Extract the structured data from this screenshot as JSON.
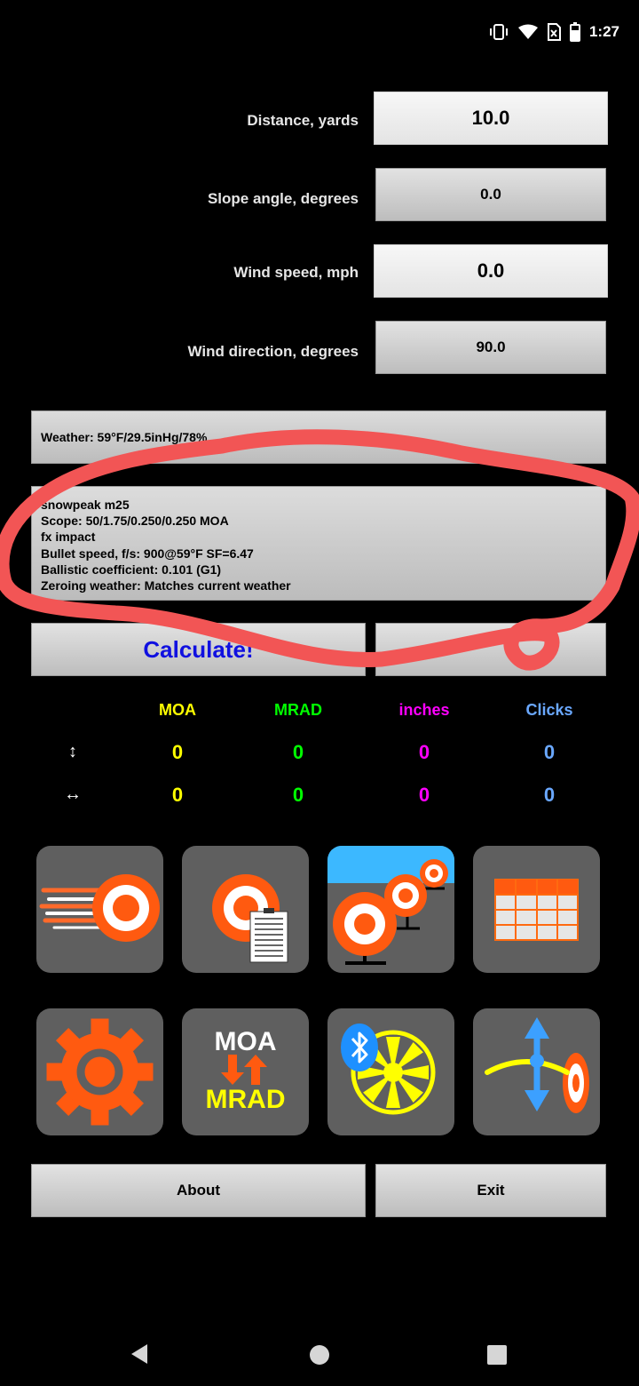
{
  "status": {
    "time": "1:27"
  },
  "inputs": [
    {
      "label": "Distance, yards",
      "value": "10.0"
    },
    {
      "label": "Slope angle, degrees",
      "value": "0.0"
    },
    {
      "label": "Wind speed, mph",
      "value": "0.0"
    },
    {
      "label": "Wind direction, degrees",
      "value": "90.0"
    }
  ],
  "weather": "Weather: 59°F/29.5inHg/78%",
  "profile": {
    "name": "snowpeak m25",
    "scope": "Scope: 50/1.75/0.250/0.250 MOA",
    "ammo": "fx impact",
    "bullet_speed": "Bullet speed, f/s: 900@59°F SF=6.47",
    "ballistic_coefficient": "Ballistic coefficient: 0.101 (G1)",
    "zeroing_weather": "Zeroing weather: Matches current weather"
  },
  "calculate_label": "Calculate!",
  "secondary_label": "",
  "results": {
    "headers": [
      "MOA",
      "MRAD",
      "inches",
      "Clicks"
    ],
    "header_colors": [
      "#ffff00",
      "#00ff00",
      "#ff00ff",
      "#6aa8ff"
    ],
    "vertical_icon": "↕",
    "horizontal_icon": "↔",
    "vertical": [
      "0",
      "0",
      "0",
      "0"
    ],
    "horizontal": [
      "0",
      "0",
      "0",
      "0"
    ]
  },
  "tiles": {
    "moa": "MOA",
    "mrad": "MRAD"
  },
  "bottom_buttons": {
    "about": "About",
    "exit": "Exit"
  },
  "icons": [
    "vibrate-icon",
    "wifi-icon",
    "sim-icon",
    "battery-icon",
    "bullet-target-icon",
    "target-notes-icon",
    "multi-target-icon",
    "table-icon",
    "settings-gear-icon",
    "moa-mrad-convert-icon",
    "bluetooth-wind-meter-icon",
    "trajectory-icon",
    "back-nav-icon",
    "home-nav-icon",
    "recents-nav-icon"
  ]
}
